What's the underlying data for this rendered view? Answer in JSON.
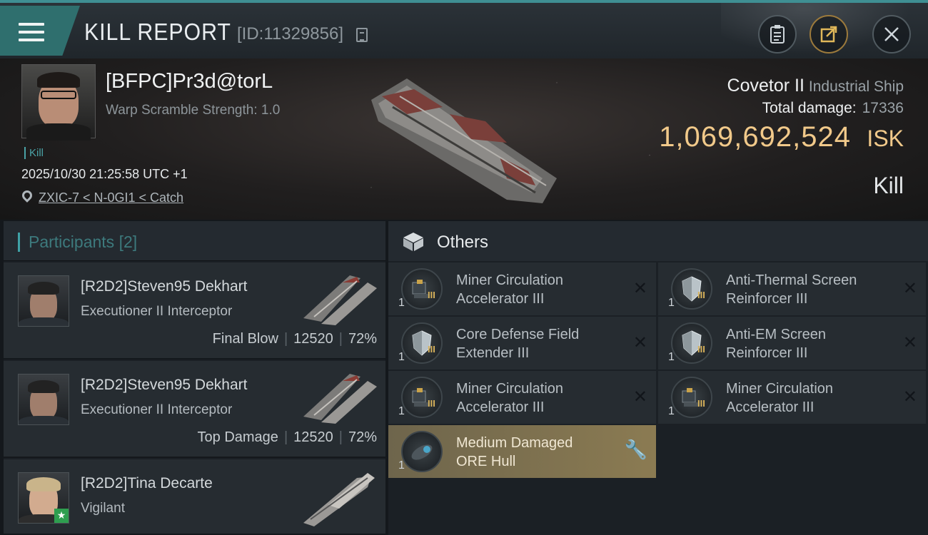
{
  "header": {
    "title": "KILL REPORT",
    "report_id": "[ID:11329856]"
  },
  "victim": {
    "name": "[BFPC]Pr3d@torL",
    "warp_scramble": "Warp Scramble Strength: 1.0",
    "tag": "Kill",
    "timestamp": "2025/10/30 21:25:58 UTC +1",
    "location": "ZXIC-7 < N-0GI1 < Catch",
    "ship_name": "Covetor II",
    "ship_class": "Industrial Ship",
    "damage_label": "Total damage:",
    "damage_value": "17336",
    "isk_value": "1,069,692,524",
    "isk_label": "ISK",
    "result": "Kill"
  },
  "participants": {
    "title": "Participants",
    "count": "[2]",
    "items": [
      {
        "name": "[R2D2]Steven95 Dekhart",
        "ship": "Executioner II Interceptor",
        "role": "Final Blow",
        "damage": "12520",
        "percent": "72%"
      },
      {
        "name": "[R2D2]Steven95 Dekhart",
        "ship": "Executioner II Interceptor",
        "role": "Top Damage",
        "damage": "12520",
        "percent": "72%"
      },
      {
        "name": "[R2D2]Tina Decarte",
        "ship": "Vigilant"
      }
    ]
  },
  "others": {
    "title": "Others",
    "modules": [
      {
        "line1": "Miner Circulation",
        "line2": "Accelerator III",
        "qty": "1",
        "meta": "III"
      },
      {
        "line1": "Anti-Thermal Screen",
        "line2": "Reinforcer III",
        "qty": "1",
        "meta": "III"
      },
      {
        "line1": "Core Defense Field",
        "line2": "Extender III",
        "qty": "1",
        "meta": "III"
      },
      {
        "line1": "Anti-EM Screen",
        "line2": "Reinforcer III",
        "qty": "1",
        "meta": "III"
      },
      {
        "line1": "Miner Circulation",
        "line2": "Accelerator III",
        "qty": "1",
        "meta": "III"
      },
      {
        "line1": "Miner Circulation",
        "line2": "Accelerator III",
        "qty": "1",
        "meta": "III"
      },
      {
        "line1": "Medium Damaged",
        "line2": "ORE Hull",
        "qty": "1"
      }
    ]
  },
  "icons": [
    "menu-icon",
    "copy-icon",
    "clipboard-icon",
    "share-icon",
    "close-icon",
    "location-icon",
    "box-icon",
    "destroyed-icon",
    "wrench-icon",
    "star-icon"
  ],
  "colors": {
    "accent": "#3fa1a6",
    "isk": "#f1c98a",
    "highlight": "#8b7b52"
  }
}
